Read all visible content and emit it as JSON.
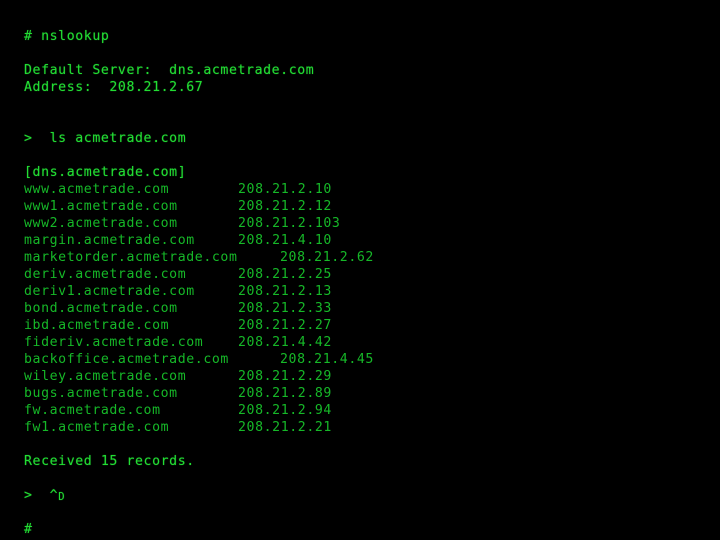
{
  "terminal": {
    "background_color": "#000000",
    "text_color": "#16b828",
    "bright_text_color": "#22dd33",
    "shell_prompt": "#",
    "nslookup_prompt": ">"
  },
  "session": {
    "command_line": "# nslookup",
    "default_server_line": "Default Server:  dns.acmetrade.com",
    "address_line": "Address:  208.21.2.67",
    "ls_command_line": ">  ls acmetrade.com",
    "zone_header": "[dns.acmetrade.com]",
    "received_line": "Received 15 records.",
    "eof_prompt": ">",
    "eof_control": "^",
    "eof_control_key": "D",
    "final_prompt": "#"
  },
  "records": [
    {
      "host": "www.acmetrade.com",
      "ip": "208.21.2.10",
      "wide": false
    },
    {
      "host": "www1.acmetrade.com",
      "ip": "208.21.2.12",
      "wide": false
    },
    {
      "host": "www2.acmetrade.com",
      "ip": "208.21.2.103",
      "wide": false
    },
    {
      "host": "margin.acmetrade.com",
      "ip": "208.21.4.10",
      "wide": false
    },
    {
      "host": "marketorder.acmetrade.com",
      "ip": "208.21.2.62",
      "wide": true
    },
    {
      "host": "deriv.acmetrade.com",
      "ip": "208.21.2.25",
      "wide": false
    },
    {
      "host": "deriv1.acmetrade.com",
      "ip": "208.21.2.13",
      "wide": false
    },
    {
      "host": "bond.acmetrade.com",
      "ip": "208.21.2.33",
      "wide": false
    },
    {
      "host": "ibd.acmetrade.com",
      "ip": "208.21.2.27",
      "wide": false
    },
    {
      "host": "fideriv.acmetrade.com",
      "ip": "208.21.4.42",
      "wide": false
    },
    {
      "host": "backoffice.acmetrade.com",
      "ip": "208.21.4.45",
      "wide": true
    },
    {
      "host": "wiley.acmetrade.com",
      "ip": "208.21.2.29",
      "wide": false
    },
    {
      "host": "bugs.acmetrade.com",
      "ip": "208.21.2.89",
      "wide": false
    },
    {
      "host": "fw.acmetrade.com",
      "ip": "208.21.2.94",
      "wide": false
    },
    {
      "host": "fw1.acmetrade.com",
      "ip": "208.21.2.21",
      "wide": false
    }
  ]
}
